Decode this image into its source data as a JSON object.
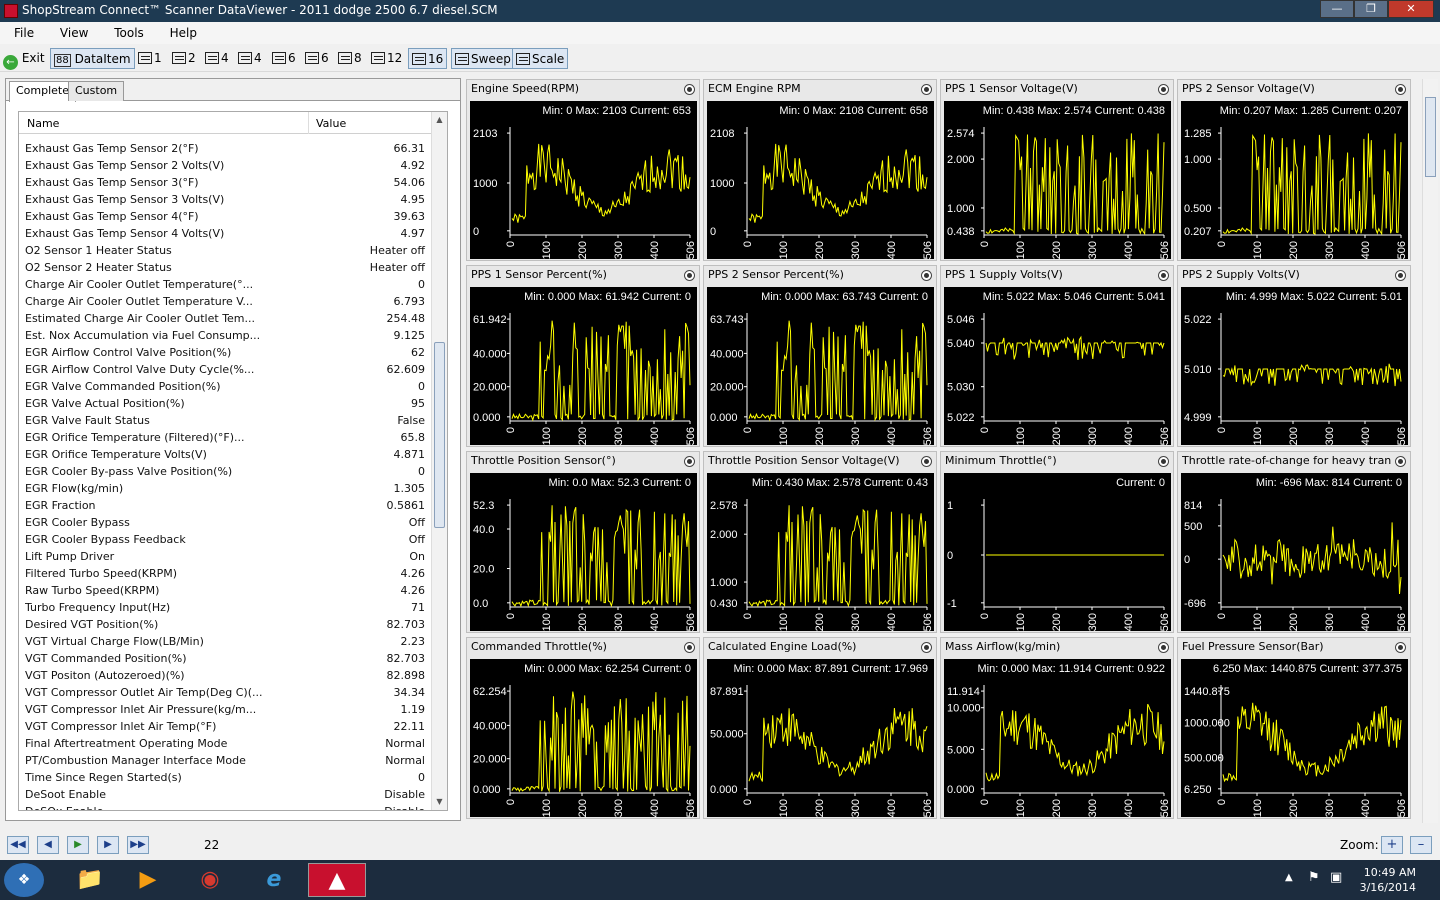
{
  "window": {
    "title": "ShopStream Connect™ Scanner DataViewer - 2011 dodge 2500 6.7 diesel.SCM"
  },
  "menu": [
    "File",
    "View",
    "Tools",
    "Help"
  ],
  "toolbar": {
    "exit": "Exit",
    "dataitem": "DataItem",
    "layouts": [
      "1",
      "2",
      "4",
      "4",
      "6",
      "6",
      "8",
      "12",
      "16"
    ],
    "sweep": "Sweep",
    "scale": "Scale"
  },
  "tabs": [
    "Complete",
    "Custom"
  ],
  "list": {
    "headers": [
      "Name",
      "Value"
    ],
    "rows": [
      [
        "Exhaust Gas Temp Sensor 2(°F)",
        "66.31"
      ],
      [
        "Exhaust Gas Temp Sensor 2 Volts(V)",
        "4.92"
      ],
      [
        "Exhaust Gas Temp Sensor 3(°F)",
        "54.06"
      ],
      [
        "Exhaust Gas Temp Sensor 3 Volts(V)",
        "4.95"
      ],
      [
        "Exhaust Gas Temp Sensor 4(°F)",
        "39.63"
      ],
      [
        "Exhaust Gas Temp Sensor 4 Volts(V)",
        "4.97"
      ],
      [
        "O2 Sensor 1 Heater Status",
        "Heater off"
      ],
      [
        "O2 Sensor 2 Heater Status",
        "Heater off"
      ],
      [
        "Charge Air Cooler Outlet Temperature(°...",
        "0"
      ],
      [
        "Charge Air Cooler Outlet Temperature V...",
        "6.793"
      ],
      [
        "Estimated Charge Air Cooler Outlet Tem...",
        "254.48"
      ],
      [
        "Est. Nox Accumulation via Fuel Consump...",
        "9.125"
      ],
      [
        "EGR Airflow Control Valve Position(%)",
        "62"
      ],
      [
        "EGR Airflow Control Valve Duty Cycle(%...",
        "62.609"
      ],
      [
        "EGR Valve Commanded Position(%)",
        "0"
      ],
      [
        "EGR Valve Actual Position(%)",
        "95"
      ],
      [
        "EGR Valve Fault Status",
        "False"
      ],
      [
        "EGR Orifice Temperature (Filtered)(°F)...",
        "65.8"
      ],
      [
        "EGR Orifice Temperature Volts(V)",
        "4.871"
      ],
      [
        "EGR Cooler By-pass Valve Position(%)",
        "0"
      ],
      [
        "EGR Flow(kg/min)",
        "1.305"
      ],
      [
        "EGR Fraction",
        "0.5861"
      ],
      [
        "EGR Cooler Bypass",
        "Off"
      ],
      [
        "EGR Cooler Bypass Feedback",
        "Off"
      ],
      [
        "Lift Pump Driver",
        "On"
      ],
      [
        "Filtered Turbo Speed(KRPM)",
        "4.26"
      ],
      [
        "Raw Turbo Speed(KRPM)",
        "4.26"
      ],
      [
        "Turbo Frequency Input(Hz)",
        "71"
      ],
      [
        "Desired VGT Position(%)",
        "82.703"
      ],
      [
        "VGT Virtual Charge Flow(LB/Min)",
        "2.23"
      ],
      [
        "VGT Commanded Position(%)",
        "82.703"
      ],
      [
        "VGT Positon (Autozeroed)(%)",
        "82.898"
      ],
      [
        "VGT Compressor Outlet Air Temp(Deg C)(...",
        "34.34"
      ],
      [
        "VGT Compressor Inlet Air Pressure(kg/m...",
        "1.19"
      ],
      [
        "VGT Compressor Inlet Air Temp(°F)",
        "22.11"
      ],
      [
        "Final Aftertreatment Operating Mode",
        "Normal"
      ],
      [
        "PT/Combustion Manager Interface Mode",
        "Normal"
      ],
      [
        "Time Since Regen Started(s)",
        "0"
      ],
      [
        "DeSoot Enable",
        "Disable"
      ],
      [
        "DeSOx Enable",
        "Disable"
      ]
    ]
  },
  "x_ticks": [
    "0",
    "100",
    "200",
    "300",
    "400",
    "506"
  ],
  "graphs": [
    {
      "title": "Engine Speed(RPM)",
      "stats": "Min: 0    Max: 2103    Current: 653",
      "yticks": [
        "2103",
        "1000",
        "0"
      ],
      "ypos": [
        0.02,
        0.5,
        0.96
      ],
      "style": "wave",
      "seed": 1
    },
    {
      "title": "ECM Engine RPM",
      "stats": "Min: 0    Max: 2108    Current: 658",
      "yticks": [
        "2108",
        "1000",
        "0"
      ],
      "ypos": [
        0.02,
        0.5,
        0.96
      ],
      "style": "wave",
      "seed": 1
    },
    {
      "title": "PPS 1 Sensor Voltage(V)",
      "stats": "Min: 0.438    Max: 2.574    Current: 0.438",
      "yticks": [
        "2.574",
        "2.000",
        "1.000",
        "0.438"
      ],
      "ypos": [
        0.02,
        0.27,
        0.74,
        0.96
      ],
      "style": "spiky",
      "seed": 2
    },
    {
      "title": "PPS 2 Sensor Voltage(V)",
      "stats": "Min: 0.207    Max: 1.285    Current: 0.207",
      "yticks": [
        "1.285",
        "1.000",
        "0.500",
        "0.207"
      ],
      "ypos": [
        0.02,
        0.27,
        0.74,
        0.96
      ],
      "style": "spiky",
      "seed": 2
    },
    {
      "title": "PPS 1 Sensor Percent(%)",
      "stats": "Min: 0.000    Max: 61.942    Current: 0",
      "yticks": [
        "61.942",
        "40.000",
        "20.000",
        "0.000"
      ],
      "ypos": [
        0.02,
        0.35,
        0.67,
        0.96
      ],
      "style": "spiky",
      "seed": 3
    },
    {
      "title": "PPS 2 Sensor Percent(%)",
      "stats": "Min: 0.000    Max: 63.743    Current: 0",
      "yticks": [
        "63.743",
        "40.000",
        "20.000",
        "0.000"
      ],
      "ypos": [
        0.02,
        0.35,
        0.67,
        0.96
      ],
      "style": "spiky",
      "seed": 3
    },
    {
      "title": "PPS 1 Supply Volts(V)",
      "stats": "Min: 5.022    Max: 5.046    Current: 5.041",
      "yticks": [
        "5.046",
        "5.040",
        "5.030",
        "5.022"
      ],
      "ypos": [
        0.02,
        0.25,
        0.67,
        0.96
      ],
      "style": "noise",
      "seed": 4
    },
    {
      "title": "PPS 2 Supply Volts(V)",
      "stats": "Min: 4.999    Max: 5.022    Current: 5.01",
      "yticks": [
        "5.022",
        "5.010",
        "4.999"
      ],
      "ypos": [
        0.02,
        0.5,
        0.96
      ],
      "style": "noise",
      "seed": 5
    },
    {
      "title": "Throttle Position Sensor(°)",
      "stats": "Min: 0.0    Max: 52.3    Current: 0",
      "yticks": [
        "52.3",
        "40.0",
        "20.0",
        "0.0"
      ],
      "ypos": [
        0.02,
        0.25,
        0.63,
        0.96
      ],
      "style": "spiky",
      "seed": 6
    },
    {
      "title": "Throttle Position Sensor Voltage(V)",
      "stats": "Min: 0.430    Max: 2.578    Current: 0.43",
      "yticks": [
        "2.578",
        "2.000",
        "1.000",
        "0.430"
      ],
      "ypos": [
        0.02,
        0.3,
        0.76,
        0.96
      ],
      "style": "spiky",
      "seed": 6
    },
    {
      "title": "Minimum Throttle(°)",
      "stats": "Current: 0",
      "yticks": [
        "1",
        "0",
        "-1"
      ],
      "ypos": [
        0.02,
        0.5,
        0.96
      ],
      "style": "flat",
      "seed": 7
    },
    {
      "title": "Throttle rate-of-change for heavy tran...",
      "stats": "Min: -696    Max: 814    Current: 0",
      "yticks": [
        "814",
        "500",
        "0",
        "-696"
      ],
      "ypos": [
        0.02,
        0.22,
        0.54,
        0.96
      ],
      "style": "center",
      "seed": 8
    },
    {
      "title": "Commanded Throttle(%)",
      "stats": "Min: 0.000    Max: 62.254    Current: 0",
      "yticks": [
        "62.254",
        "40.000",
        "20.000",
        "0.000"
      ],
      "ypos": [
        0.02,
        0.35,
        0.67,
        0.96
      ],
      "style": "spiky",
      "seed": 9
    },
    {
      "title": "Calculated Engine Load(%)",
      "stats": "Min: 0.000    Max: 87.891    Current: 17.969",
      "yticks": [
        "87.891",
        "50.000",
        "0.000"
      ],
      "ypos": [
        0.02,
        0.43,
        0.96
      ],
      "style": "wave",
      "seed": 10
    },
    {
      "title": "Mass Airflow(kg/min)",
      "stats": "Min: 0.000    Max: 11.914    Current: 0.922",
      "yticks": [
        "11.914",
        "10.000",
        "5.000",
        "0.000"
      ],
      "ypos": [
        0.02,
        0.18,
        0.58,
        0.96
      ],
      "style": "wave",
      "seed": 11
    },
    {
      "title": "Fuel Pressure Sensor(Bar)",
      "stats": "6.250    Max: 1440.875    Current: 377.375",
      "yticks": [
        "1440.875",
        "1000.000",
        "500.000",
        "6.250"
      ],
      "ypos": [
        0.02,
        0.32,
        0.66,
        0.96
      ],
      "style": "wave",
      "seed": 12
    }
  ],
  "bottom": {
    "frame": "22",
    "zoom_label": "Zoom:"
  },
  "clock": {
    "time": "10:49 AM",
    "date": "3/16/2014"
  },
  "colors": {
    "plot_bg": "#000000",
    "trace": "#ffff00",
    "axis": "#ffffff"
  }
}
